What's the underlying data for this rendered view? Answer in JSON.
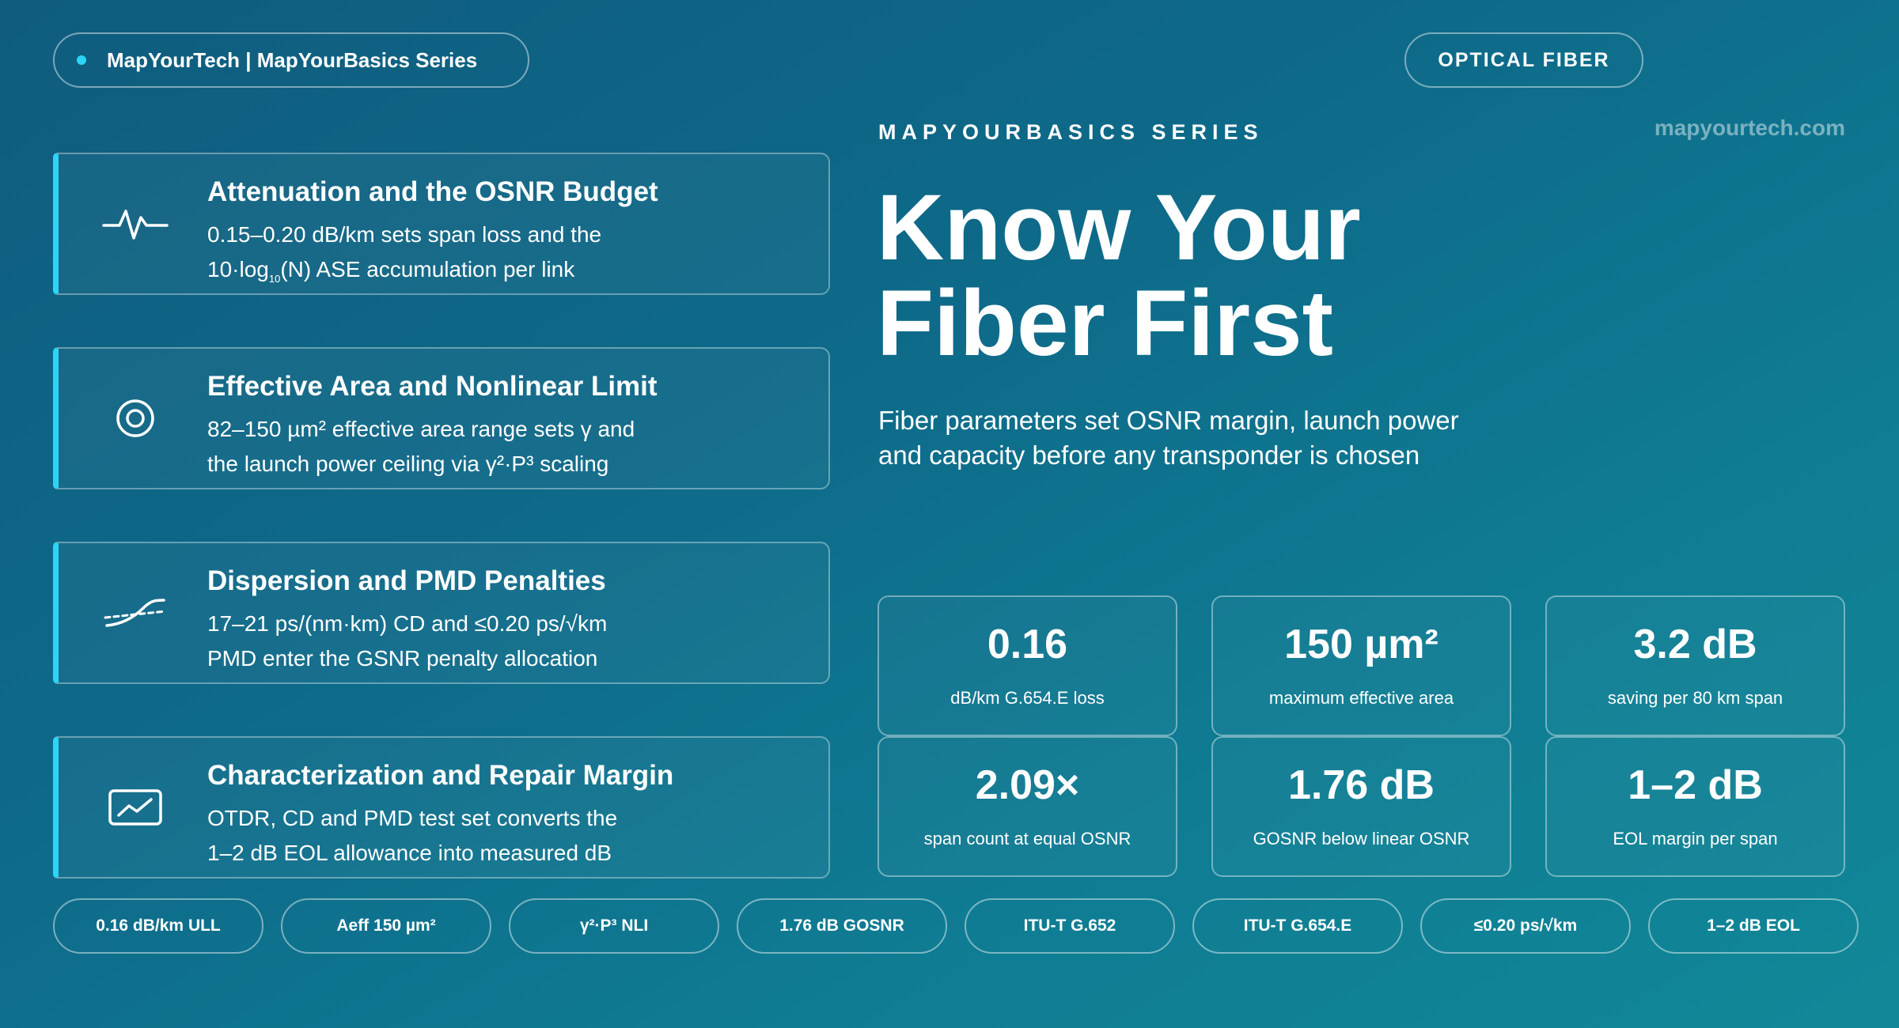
{
  "header": {
    "brand": "MapYourTech | MapYourBasics Series",
    "topic": "OPTICAL FIBER"
  },
  "hero": {
    "series_label": "MAPYOURBASICS SERIES",
    "site": "mapyourtech.com",
    "title_line1": "Know Your",
    "title_line2": "Fiber First",
    "subtitle_line1": "Fiber parameters set OSNR margin, launch power",
    "subtitle_line2": "and capacity before any transponder is chosen"
  },
  "features": [
    {
      "icon": "pulse-icon",
      "title": "Attenuation and the OSNR Budget",
      "line1": "0.15–0.20 dB/km sets span loss and the",
      "line2_pre": "10·log",
      "line2_sub": "10",
      "line2_post": "(N) ASE accumulation per link"
    },
    {
      "icon": "target-icon",
      "title": "Effective Area and Nonlinear Limit",
      "line1": "82–150 µm² effective area range sets γ and",
      "line2": "the launch power ceiling via γ²·P³ scaling"
    },
    {
      "icon": "dispersion-curve-icon",
      "title": "Dispersion and PMD Penalties",
      "line1": "17–21 ps/(nm·km) CD and ≤0.20 ps/√km",
      "line2": "PMD enter the GSNR penalty allocation"
    },
    {
      "icon": "monitor-chart-icon",
      "title": "Characterization and Repair Margin",
      "line1": "OTDR, CD and PMD test set converts the",
      "line2": "1–2 dB EOL allowance into measured dB"
    }
  ],
  "stats": [
    {
      "value": "0.16",
      "label": "dB/km G.654.E loss"
    },
    {
      "value": "150 µm²",
      "label": "maximum effective area"
    },
    {
      "value": "3.2 dB",
      "label": "saving per 80 km span"
    },
    {
      "value": "2.09×",
      "label": "span count at equal OSNR"
    },
    {
      "value": "1.76 dB",
      "label": "GOSNR below linear OSNR"
    },
    {
      "value": "1–2 dB",
      "label": "EOL margin per span"
    }
  ],
  "tags": [
    "0.16 dB/km ULL",
    "Aeff 150 µm²",
    "γ²·P³ NLI",
    "1.76 dB GOSNR",
    "ITU-T G.652",
    "ITU-T G.654.E",
    "≤0.20 ps/√km",
    "1–2 dB EOL"
  ],
  "colors": {
    "accent": "#2cd5f5",
    "background_start": "#0f5c7e",
    "background_end": "#118898"
  }
}
